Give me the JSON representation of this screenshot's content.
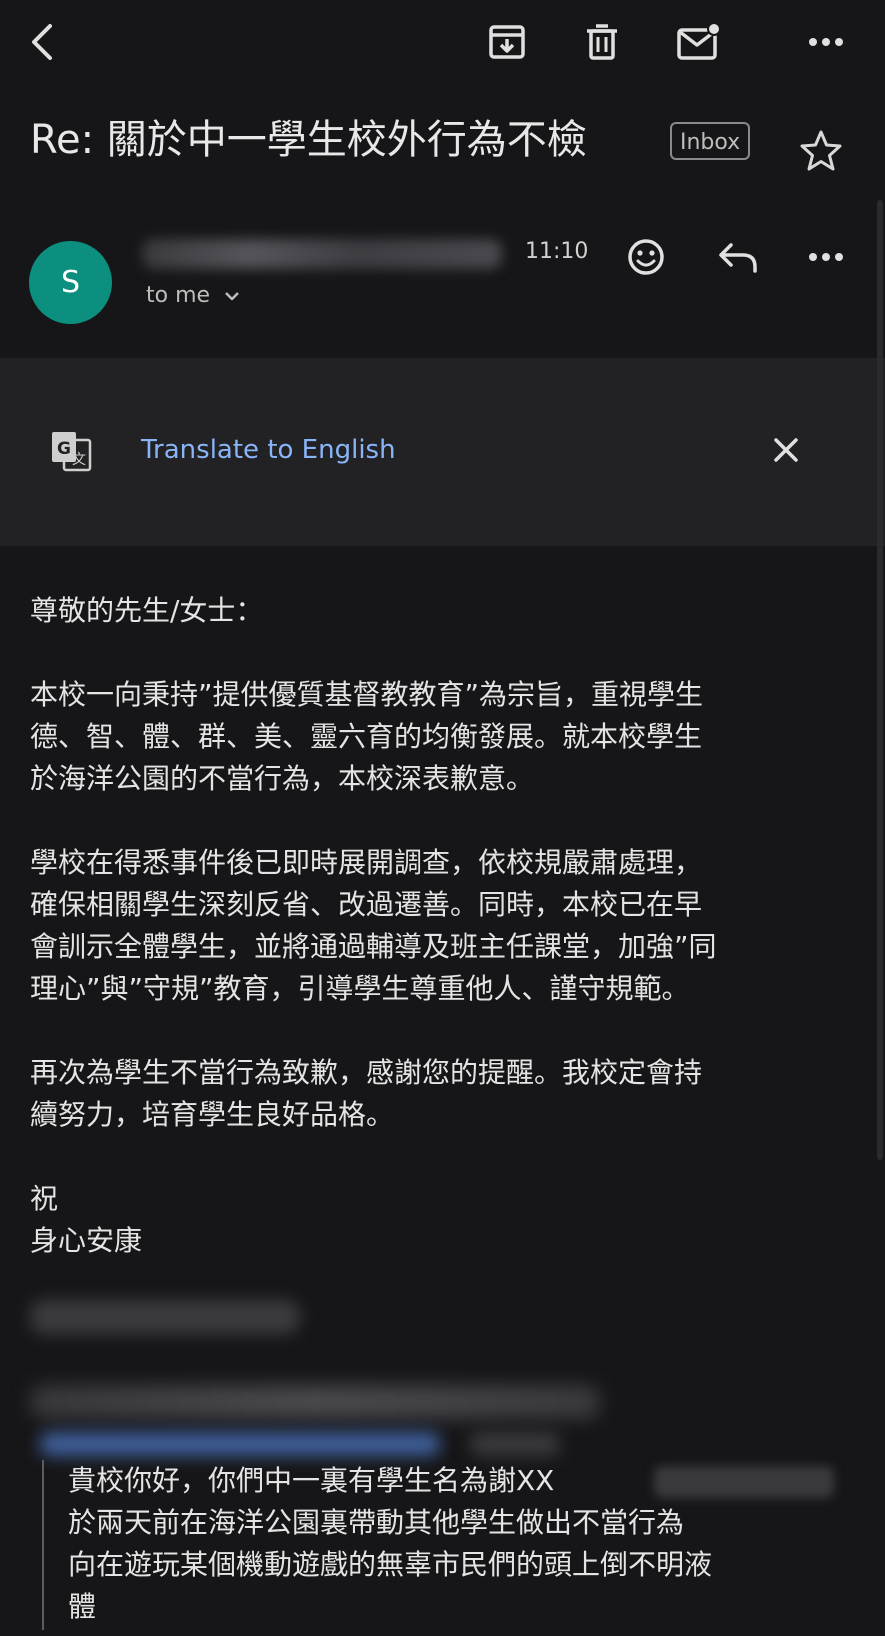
{
  "toolbar": {
    "back_icon": "back-arrow-icon",
    "archive_icon": "archive-icon",
    "delete_icon": "trash-icon",
    "mark_unread_icon": "mark-unread-icon",
    "more_icon": "more-vert-icon"
  },
  "email": {
    "subject": "Re: 關於中一學生校外行為不檢",
    "label": "Inbox",
    "sender_initial": "S",
    "recipient": "to me",
    "time": "11:10"
  },
  "translate": {
    "link_text": "Translate to English"
  },
  "body": {
    "greeting": "尊敬的先生/女士：",
    "para1": "本校一向秉持”提供優質基督教教育”為宗旨，重視學生\n德、智、體、群、美、靈六育的均衡發展。就本校學生\n於海洋公園的不當行為，本校深表歉意。",
    "para2": "學校在得悉事件後已即時展開調查，依校規嚴肅處理，\n確保相關學生深刻反省、改過遷善。同時，本校已在早\n會訓示全體學生，並將通過輔導及班主任課堂，加強”同\n理心”與”守規”教育，引導學生尊重他人、謹守規範。",
    "para3": "再次為學生不當行為致歉，感謝您的提醒。我校定會持\n續努力，培育學生良好品格。",
    "closing1": "祝",
    "closing2": "身心安康"
  },
  "quoted": {
    "text": "貴校你好，你們中一裏有學生名為謝XX\n於兩天前在海洋公園裏帶動其他學生做出不當行為\n向在遊玩某個機動遊戲的無辜市民們的頭上倒不明液\n體"
  }
}
